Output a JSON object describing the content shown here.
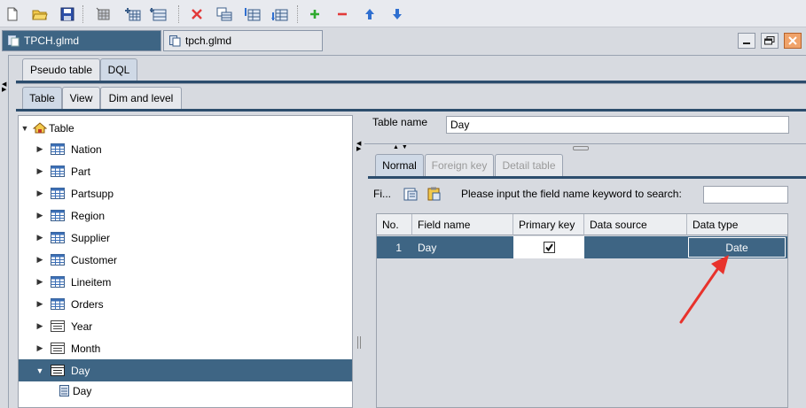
{
  "toolbar": {
    "buttons": [
      "new-file-icon",
      "open-folder-icon",
      "save-icon",
      "table-icon",
      "add-table-icon",
      "add-view-icon",
      "delete-icon",
      "copy-table-icon",
      "import-table-icon",
      "export-table-icon",
      "add-row-icon",
      "delete-row-icon",
      "move-up-icon",
      "move-down-icon"
    ],
    "colors": {
      "add": "#2eaa2e",
      "delete": "#e23a3a",
      "arrow": "#2f6fd0"
    }
  },
  "doc_tabs": [
    {
      "label": "TPCH.glmd",
      "active": true
    },
    {
      "label": "tpch.glmd",
      "active": false
    }
  ],
  "mode_tabs": [
    {
      "label": "Pseudo table",
      "selected": false
    },
    {
      "label": "DQL",
      "selected": true
    }
  ],
  "view_tabs": [
    {
      "label": "Table",
      "selected": true
    },
    {
      "label": "View",
      "selected": false
    },
    {
      "label": "Dim and level",
      "selected": false
    }
  ],
  "tree": {
    "root": "Table",
    "items": [
      {
        "label": "Nation",
        "icon": "table-icon"
      },
      {
        "label": "Part",
        "icon": "table-icon"
      },
      {
        "label": "Partsupp",
        "icon": "table-icon"
      },
      {
        "label": "Region",
        "icon": "table-icon"
      },
      {
        "label": "Supplier",
        "icon": "table-icon"
      },
      {
        "label": "Customer",
        "icon": "table-icon"
      },
      {
        "label": "Lineitem",
        "icon": "table-icon"
      },
      {
        "label": "Orders",
        "icon": "table-icon"
      },
      {
        "label": "Year",
        "icon": "dim-table-icon"
      },
      {
        "label": "Month",
        "icon": "dim-table-icon"
      },
      {
        "label": "Day",
        "icon": "dim-table-icon",
        "selected": true,
        "expanded": true
      }
    ],
    "child": {
      "label": "Day",
      "icon": "field-icon"
    }
  },
  "table_name": {
    "label": "Table name",
    "value": "Day"
  },
  "detail_tabs": [
    {
      "label": "Normal",
      "selected": true,
      "disabled": false
    },
    {
      "label": "Foreign key",
      "selected": false,
      "disabled": true
    },
    {
      "label": "Detail table",
      "selected": false,
      "disabled": true
    }
  ],
  "fields_bar": {
    "label": "Fi...",
    "search_prompt": "Please input the field name keyword to search:",
    "search_value": ""
  },
  "grid": {
    "columns": [
      "No.",
      "Field name",
      "Primary key",
      "Data source",
      "Data type"
    ],
    "rows": [
      {
        "no": "1",
        "field_name": "Day",
        "primary_key": true,
        "data_source": "",
        "data_type": "Date"
      }
    ]
  },
  "colors": {
    "selection": "#3e6584",
    "annotation_arrow": "#e8322c"
  }
}
